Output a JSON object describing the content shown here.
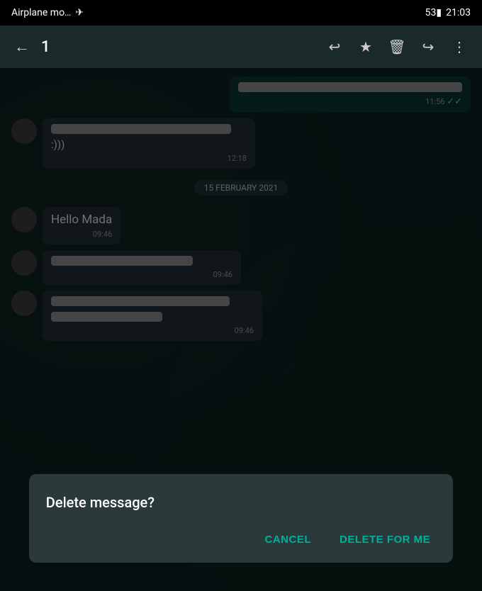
{
  "statusBar": {
    "left": "Airplane mo…",
    "planeIcon": "✈",
    "battery": "53",
    "time": "21:03"
  },
  "toolbar": {
    "backIcon": "←",
    "count": "1",
    "replyIcon": "↩",
    "starIcon": "★",
    "deleteIcon": "🗑",
    "forwardIcon": "↪",
    "moreIcon": "⋮"
  },
  "messages": [
    {
      "type": "outgoing",
      "hasRedacted": true,
      "redactedWidths": [
        "100%"
      ],
      "text": "",
      "time": "11:56",
      "ticks": "✓✓",
      "selected": true
    },
    {
      "type": "incoming",
      "hasRedacted": true,
      "redactedWidths": [
        "90%"
      ],
      "text": ":)))",
      "time": "12:18"
    }
  ],
  "dateSeparator": "15 FEBRUARY 2021",
  "messages2": [
    {
      "type": "incoming",
      "text": "Hello Mada",
      "time": "09:46"
    },
    {
      "type": "incoming",
      "hasRedacted": true,
      "redactedWidths": [
        "75%"
      ],
      "text": "",
      "time": "09:46"
    },
    {
      "type": "incoming",
      "hasRedacted": true,
      "redactedWidths": [
        "85%",
        "55%"
      ],
      "text": "",
      "time": "09:46"
    }
  ],
  "dialog": {
    "title": "Delete message?",
    "cancelLabel": "CANCEL",
    "deleteLabel": "DELETE FOR ME"
  }
}
